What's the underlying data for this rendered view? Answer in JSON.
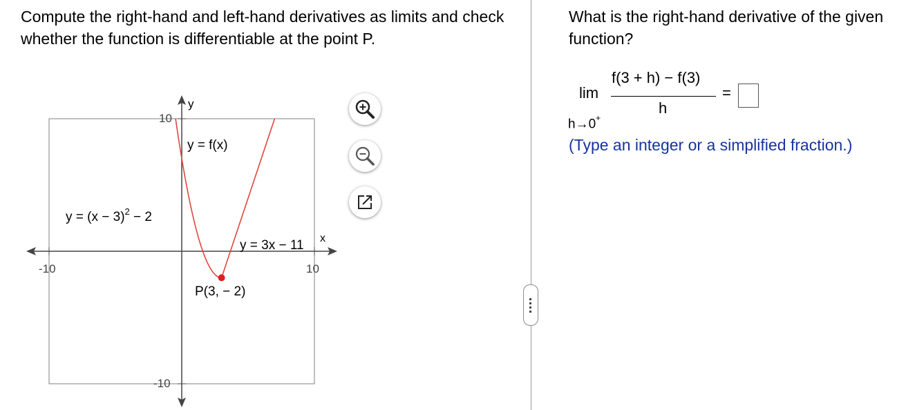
{
  "question": {
    "text": "Compute the right-hand and left-hand derivatives as limits and check whether the function is differentiable at the point P."
  },
  "graph": {
    "axis_y_label": "y",
    "axis_x_label": "x",
    "tick_x_min": "-10",
    "tick_x_max": "10",
    "tick_y_max": "10",
    "tick_y_min": "-10",
    "label_fx": "y = f(x)",
    "label_parabola_main": "y = (x − 3)",
    "label_parabola_exp": "2",
    "label_parabola_tail": " − 2",
    "label_line": "y = 3x − 11",
    "label_point": "P(3, − 2)",
    "curve_color": "#e0463c",
    "point_color": "#e02020"
  },
  "tools": {
    "zoom_in_icon": "zoom-in-icon",
    "zoom_out_icon": "zoom-out-icon",
    "popout_icon": "pop-out-icon"
  },
  "right_panel": {
    "prompt": "What is the right-hand derivative of the given function?",
    "lim": "lim",
    "numerator": "f(3 + h) − f(3)",
    "denominator": "h",
    "limit_sub": "h→0",
    "limit_sup": "+",
    "equals": "=",
    "answer_value": "",
    "hint": "(Type an integer or a simplified fraction.)",
    "hint_color": "#17339e"
  }
}
